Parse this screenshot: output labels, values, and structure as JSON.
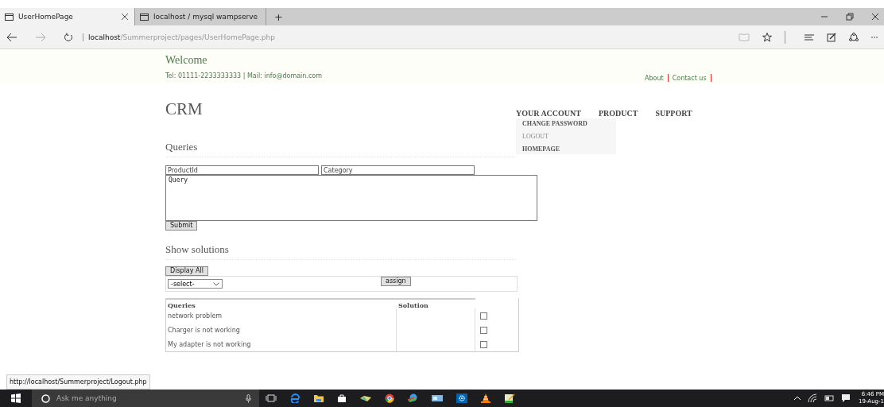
{
  "browser": {
    "tabs": [
      {
        "title": "UserHomePage",
        "selected": true
      },
      {
        "title": "localhost / mysql wampserve",
        "selected": false
      }
    ],
    "new_tab": "+",
    "address": {
      "host": "localhost",
      "path": "/Summerproject/pages/UserHomePage.php"
    },
    "status_url": "http://localhost/Summerproject/Logout.php"
  },
  "header": {
    "welcome": "Welcome",
    "contact": "Tel: 01111-2233333333 | Mail: info@domain.com",
    "links": [
      "About",
      "Contact us"
    ]
  },
  "logo": "CRM",
  "nav": [
    {
      "label": "YOUR ACCOUNT",
      "menu": [
        {
          "label": "CHANGE PASSWORD",
          "selected": false
        },
        {
          "label": "LOGOUT",
          "selected": true
        },
        {
          "label": "HOMEPAGE",
          "selected": false
        }
      ]
    },
    {
      "label": "PRODUCT"
    },
    {
      "label": "SUPPORT"
    }
  ],
  "queries": {
    "title": "Queries",
    "product_placeholder": "ProductId",
    "category_placeholder": "Category",
    "query_value": "Query",
    "submit": "Submit"
  },
  "solutions": {
    "title": "Show solutions",
    "display_all": "Display All",
    "select_value": "-select-",
    "assign": "assign",
    "columns": [
      "Queries",
      "Solution"
    ],
    "rows": [
      {
        "query": "network problem",
        "checked": false
      },
      {
        "query": "Charger is not working",
        "checked": false
      },
      {
        "query": "My adapter is not working",
        "checked": false
      }
    ]
  },
  "taskbar": {
    "search_placeholder": "Ask me anything",
    "time": "6:46 PM",
    "date": "19-Aug-1"
  }
}
